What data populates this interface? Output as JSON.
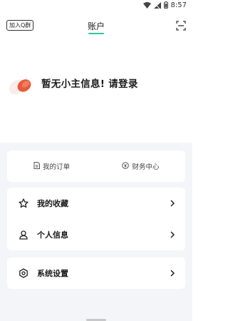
{
  "status_bar": {
    "time": "8:57"
  },
  "header": {
    "group_badge": "加入Q群",
    "title": "账户"
  },
  "profile": {
    "login_prompt": "暂无小主信息! 请登录"
  },
  "quick_links": [
    {
      "label": "我的订单",
      "icon": "document-icon"
    },
    {
      "label": "财务中心",
      "icon": "coin-icon"
    }
  ],
  "menu": [
    {
      "label": "我的收藏",
      "icon": "star-icon"
    },
    {
      "label": "个人信息",
      "icon": "user-icon"
    }
  ],
  "settings": {
    "label": "系统设置",
    "icon": "settings-icon"
  },
  "colors": {
    "accent": "#2ec4a6",
    "avatar": "#e85a3c",
    "background": "#f4f5f9"
  }
}
